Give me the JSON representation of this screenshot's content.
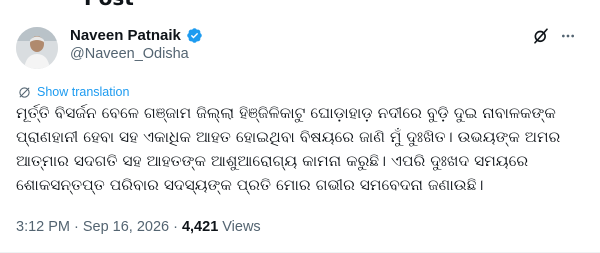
{
  "header": {
    "title": "Post"
  },
  "author": {
    "name": "Naveen Patnaik",
    "handle": "@Naveen_Odisha"
  },
  "actions": {
    "translate_label": "Show translation"
  },
  "tweet": {
    "text": "ମୂର୍ତ୍ତି ବିସର୍ଜନ ବେଳେ ଗଞ୍ଜାମ ଜିଲ୍ଲା ହିଞ୍ଜିଳିକାଟୁ ଘୋଡ଼ାହାଡ଼ ନଦୀରେ ବୁଡ଼ି ଦୁଇ ନାବାଳକଙ୍କ ପ୍ରାଣହାନୀ ହେବା ସହ ଏକାଧିକ ଆହତ ହୋଇଥିବା ବିଷୟରେ ଜାଣି ମୁଁ ଦୁଃଖିତ। ଉଭୟଙ୍କ ଅମର ଆତ୍ମାର ସଦଗତି ସହ ଆହତଙ୍କ ଆଶୁଆରୋଗ୍ୟ କାମନା କରୁଛି। ଏପରି ଦୁଃଖଦ ସମୟରେ ଶୋକସନ୍ତପ୍ତ ପରିବାର ସଦସ୍ୟଙ୍କ ପ୍ରତି ମୋର ଗଭୀର ସମବେଦନା ଜଣାଉଛି।"
  },
  "meta": {
    "time": "3:12 PM",
    "separator1": "·",
    "date": "Sep 16, 2026",
    "separator2": "·",
    "views_count": "4,421",
    "views_label": "Views"
  },
  "colors": {
    "accent": "#1d9bf0",
    "secondary_text": "#536471",
    "primary_text": "#0f1419"
  },
  "icons": {
    "verified": "verified-badge-icon",
    "grok": "grok-icon",
    "more": "more-icon",
    "translate": "translate-icon"
  }
}
